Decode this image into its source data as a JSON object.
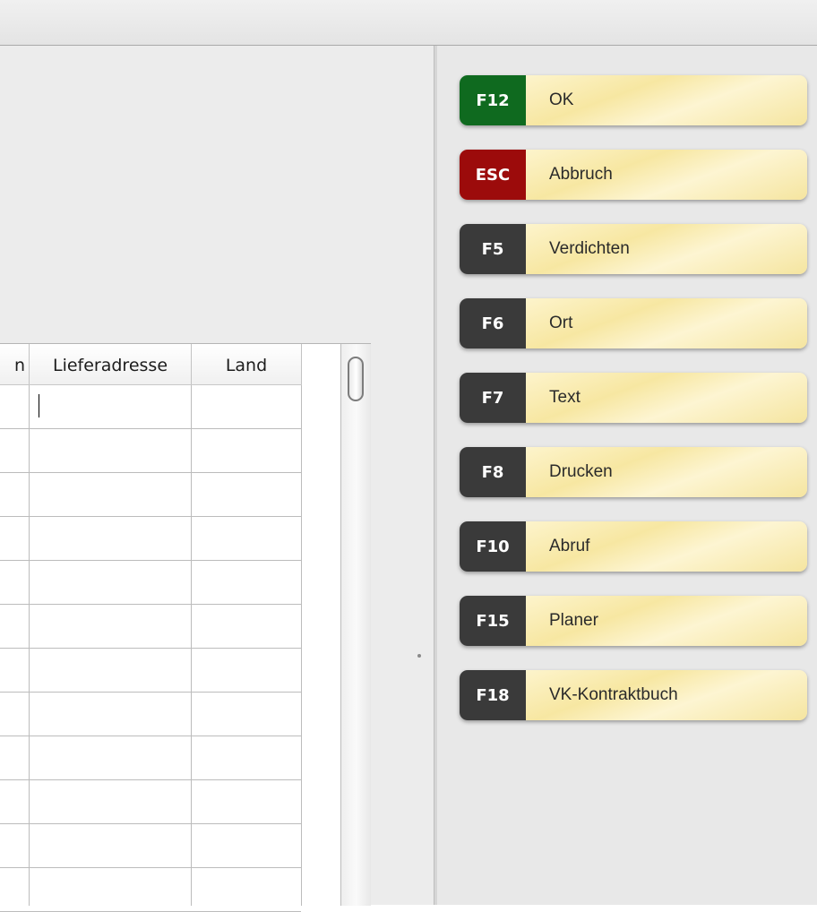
{
  "table": {
    "columns": [
      "n",
      "Lieferadresse",
      "Land"
    ],
    "row_count": 12
  },
  "function_keys": [
    {
      "key": "F12",
      "label": "OK",
      "color": "#0f6a1f"
    },
    {
      "key": "ESC",
      "label": "Abbruch",
      "color": "#9c0b0b"
    },
    {
      "key": "F5",
      "label": "Verdichten",
      "color": "#3a3a3a"
    },
    {
      "key": "F6",
      "label": "Ort",
      "color": "#3a3a3a"
    },
    {
      "key": "F7",
      "label": "Text",
      "color": "#3a3a3a"
    },
    {
      "key": "F8",
      "label": "Drucken",
      "color": "#3a3a3a"
    },
    {
      "key": "F10",
      "label": "Abruf",
      "color": "#3a3a3a"
    },
    {
      "key": "F15",
      "label": "Planer",
      "color": "#3a3a3a"
    },
    {
      "key": "F18",
      "label": "VK-Kontraktbuch",
      "color": "#3a3a3a"
    }
  ]
}
